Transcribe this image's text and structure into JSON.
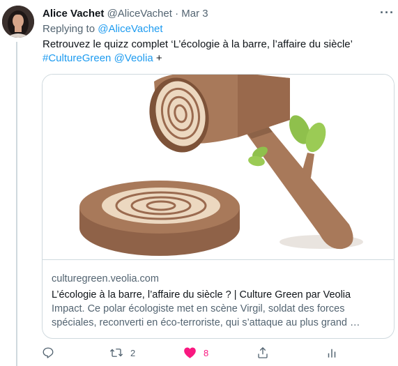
{
  "tweet": {
    "author_name": "Alice Vachet",
    "author_handle": "@AliceVachet",
    "separator": "·",
    "date": "Mar 3",
    "more_label": "···",
    "replying_prefix": "Replying to",
    "replying_to": "@AliceVachet",
    "text_line1": "Retrouvez le quizz complet ‘L’écologie à la barre, l’affaire du siècle’",
    "hashtag": "#CultureGreen",
    "mention": "@Veolia",
    "text_suffix": "+"
  },
  "card": {
    "domain": "culturegreen.veolia.com",
    "title": "L’écologie à la barre, l’affaire du siècle ? | Culture Green par Veolia",
    "description_line1": "Impact. Ce polar écologiste met en scène Virgil, soldat des forces",
    "description_line2": "spéciales, reconverti en éco-terroriste, qui s’attaque au plus grand …"
  },
  "actions": {
    "reply_count": "",
    "retweet_count": "2",
    "like_count": "8",
    "liked": true
  },
  "colors": {
    "link": "#1d9bf0",
    "like": "#f91880",
    "secondary_text": "#536471",
    "border": "#cfd9de",
    "wood": "#a77b5d",
    "leaf": "#8fc04c"
  }
}
